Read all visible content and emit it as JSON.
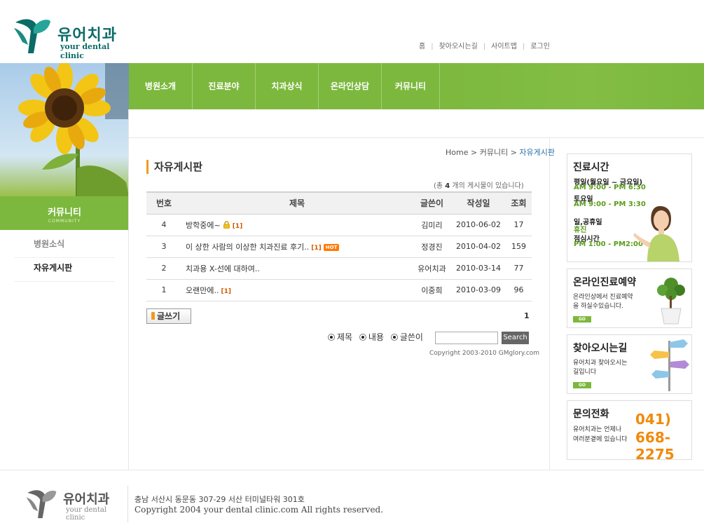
{
  "brand": {
    "name_ko": "유어치과",
    "name_en": "your dental clinic"
  },
  "top_nav": [
    "홈",
    "찾아오시는길",
    "사이트맵",
    "로그인"
  ],
  "main_nav": [
    "병원소개",
    "진료분야",
    "치과상식",
    "온라인상담",
    "커뮤니티"
  ],
  "left": {
    "section_title": "커뮤니티",
    "section_sub": "COMMUNITY",
    "menu": [
      "병원소식",
      "자유게시판"
    ]
  },
  "breadcrumb": {
    "home": "Home",
    "sep1": ">",
    "level1": "커뮤니티",
    "sep2": ">",
    "current": "자유게시판"
  },
  "page_title": "자유게시판",
  "post_count": {
    "prefix": "(총 ",
    "count": "4",
    "suffix": " 개의 게시물이 있습니다)"
  },
  "table": {
    "headers": [
      "번호",
      "제목",
      "글쓴이",
      "작성일",
      "조회"
    ],
    "rows": [
      {
        "no": "4",
        "title": "방학중에~",
        "comments": "[1]",
        "locked": true,
        "hot": false,
        "author": "김미리",
        "date": "2010-06-02",
        "views": "17"
      },
      {
        "no": "3",
        "title": "이 상한 사람의 이상한 치과진료 후기..",
        "comments": "[1]",
        "locked": false,
        "hot": true,
        "hot_label": "HOT",
        "author": "정경진",
        "date": "2010-04-02",
        "views": "159"
      },
      {
        "no": "2",
        "title": "치과용 X-선에 대하여..",
        "comments": "",
        "locked": false,
        "hot": false,
        "author": "유어치과",
        "date": "2010-03-14",
        "views": "77"
      },
      {
        "no": "1",
        "title": "오랜만에..",
        "comments": "[1]",
        "locked": false,
        "hot": false,
        "author": "이중희",
        "date": "2010-03-09",
        "views": "96"
      }
    ]
  },
  "write_button": "글쓰기",
  "pagination": "1",
  "search": {
    "options": [
      "제목",
      "내용",
      "글쓴이"
    ],
    "input_value": "",
    "button": "Search"
  },
  "board_copyright": "Copyright 2003-2010 GMglory.com",
  "right": {
    "hours": {
      "title": "진료시간",
      "weekday_label": "평일(월요일 ~ 금요일)",
      "weekday_time": "AM 9:00 - PM 6:30",
      "sat_label": "토요일",
      "sat_time": "AM 9:00 - PM 3:30",
      "holiday_label": "일,공휴일",
      "holiday_time": "휴진",
      "lunch_label": "점심시간",
      "lunch_time": "PM 1:00 - PM2:00"
    },
    "reservation": {
      "title": "온라인진료예약",
      "desc1": "온라인상에서 진료예약",
      "desc2": "을 하실수있습니다.",
      "go": "GO"
    },
    "directions": {
      "title": "찾아오시는길",
      "desc1": "유어치과 찾아오시는",
      "desc2": "길입니다",
      "go": "GO"
    },
    "phone": {
      "title": "문의전화",
      "desc1": "유어치과는 언제나",
      "desc2": "여러분곁에 있습니다",
      "num1": "041)",
      "num2": "668-2275"
    }
  },
  "footer": {
    "name_ko": "유어치과",
    "name_en": "your dental clinic",
    "address": "충남 서산시 동문동 307-29  서산 터미널타워 301호",
    "copyright": "Copyright 2004 your dental clinic.com All rights reserved."
  },
  "colors": {
    "green": "#7cb83d",
    "orange": "#f09a1e",
    "teal": "#0b6b67"
  },
  "icons": [
    "logo-leaf-icon",
    "lock-icon",
    "pen-icon",
    "radio-icon",
    "sunflower-image",
    "doctor-image",
    "plant-image",
    "signpost-image"
  ]
}
